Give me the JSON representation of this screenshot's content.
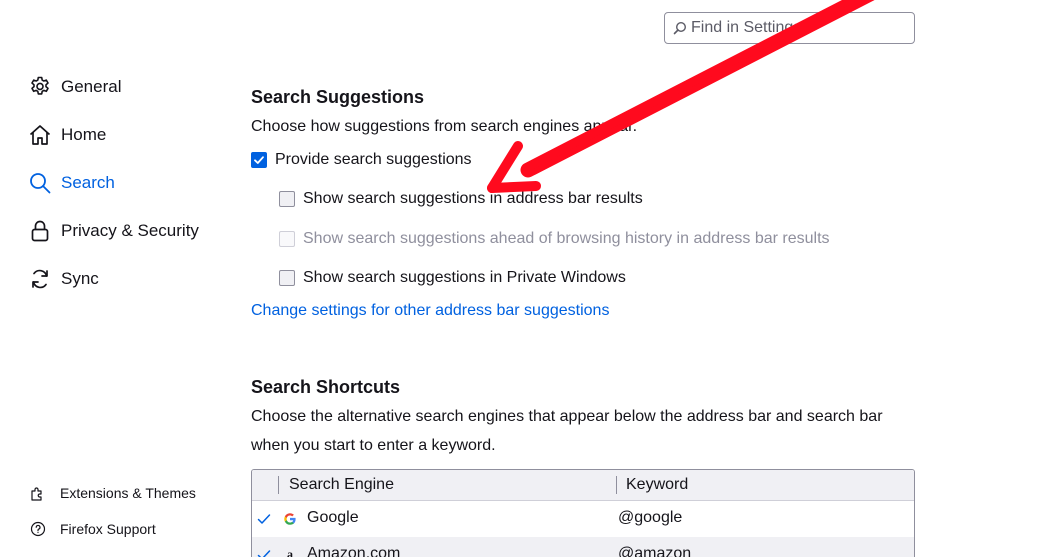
{
  "search": {
    "placeholder": "Find in Settings"
  },
  "sidebar": {
    "items": [
      {
        "label": "General",
        "icon": "gear-icon"
      },
      {
        "label": "Home",
        "icon": "home-icon"
      },
      {
        "label": "Search",
        "icon": "search-icon",
        "selected": true
      },
      {
        "label": "Privacy & Security",
        "icon": "lock-icon"
      },
      {
        "label": "Sync",
        "icon": "sync-icon"
      }
    ],
    "footer": [
      {
        "label": "Extensions & Themes",
        "icon": "puzzle-icon"
      },
      {
        "label": "Firefox Support",
        "icon": "help-icon"
      }
    ]
  },
  "suggestions": {
    "title": "Search Suggestions",
    "description": "Choose how suggestions from search engines appear.",
    "provide": {
      "label": "Provide search suggestions",
      "checked": true
    },
    "address_bar": {
      "label": "Show search suggestions in address bar results",
      "checked": false
    },
    "ahead": {
      "label": "Show search suggestions ahead of browsing history in address bar results",
      "checked": false,
      "disabled": true
    },
    "private": {
      "label": "Show search suggestions in Private Windows",
      "checked": false
    },
    "link": "Change settings for other address bar suggestions"
  },
  "shortcuts": {
    "title": "Search Shortcuts",
    "description": "Choose the alternative search engines that appear below the address bar and search bar when you start to enter a keyword.",
    "columns": [
      "Search Engine",
      "Keyword"
    ],
    "rows": [
      {
        "engine": "Google",
        "keyword": "@google",
        "checked": true
      },
      {
        "engine": "Amazon.com",
        "keyword": "@amazon",
        "checked": true
      }
    ]
  },
  "colors": {
    "accent": "#0061e0",
    "annotation_arrow": "#ff0a1e"
  }
}
